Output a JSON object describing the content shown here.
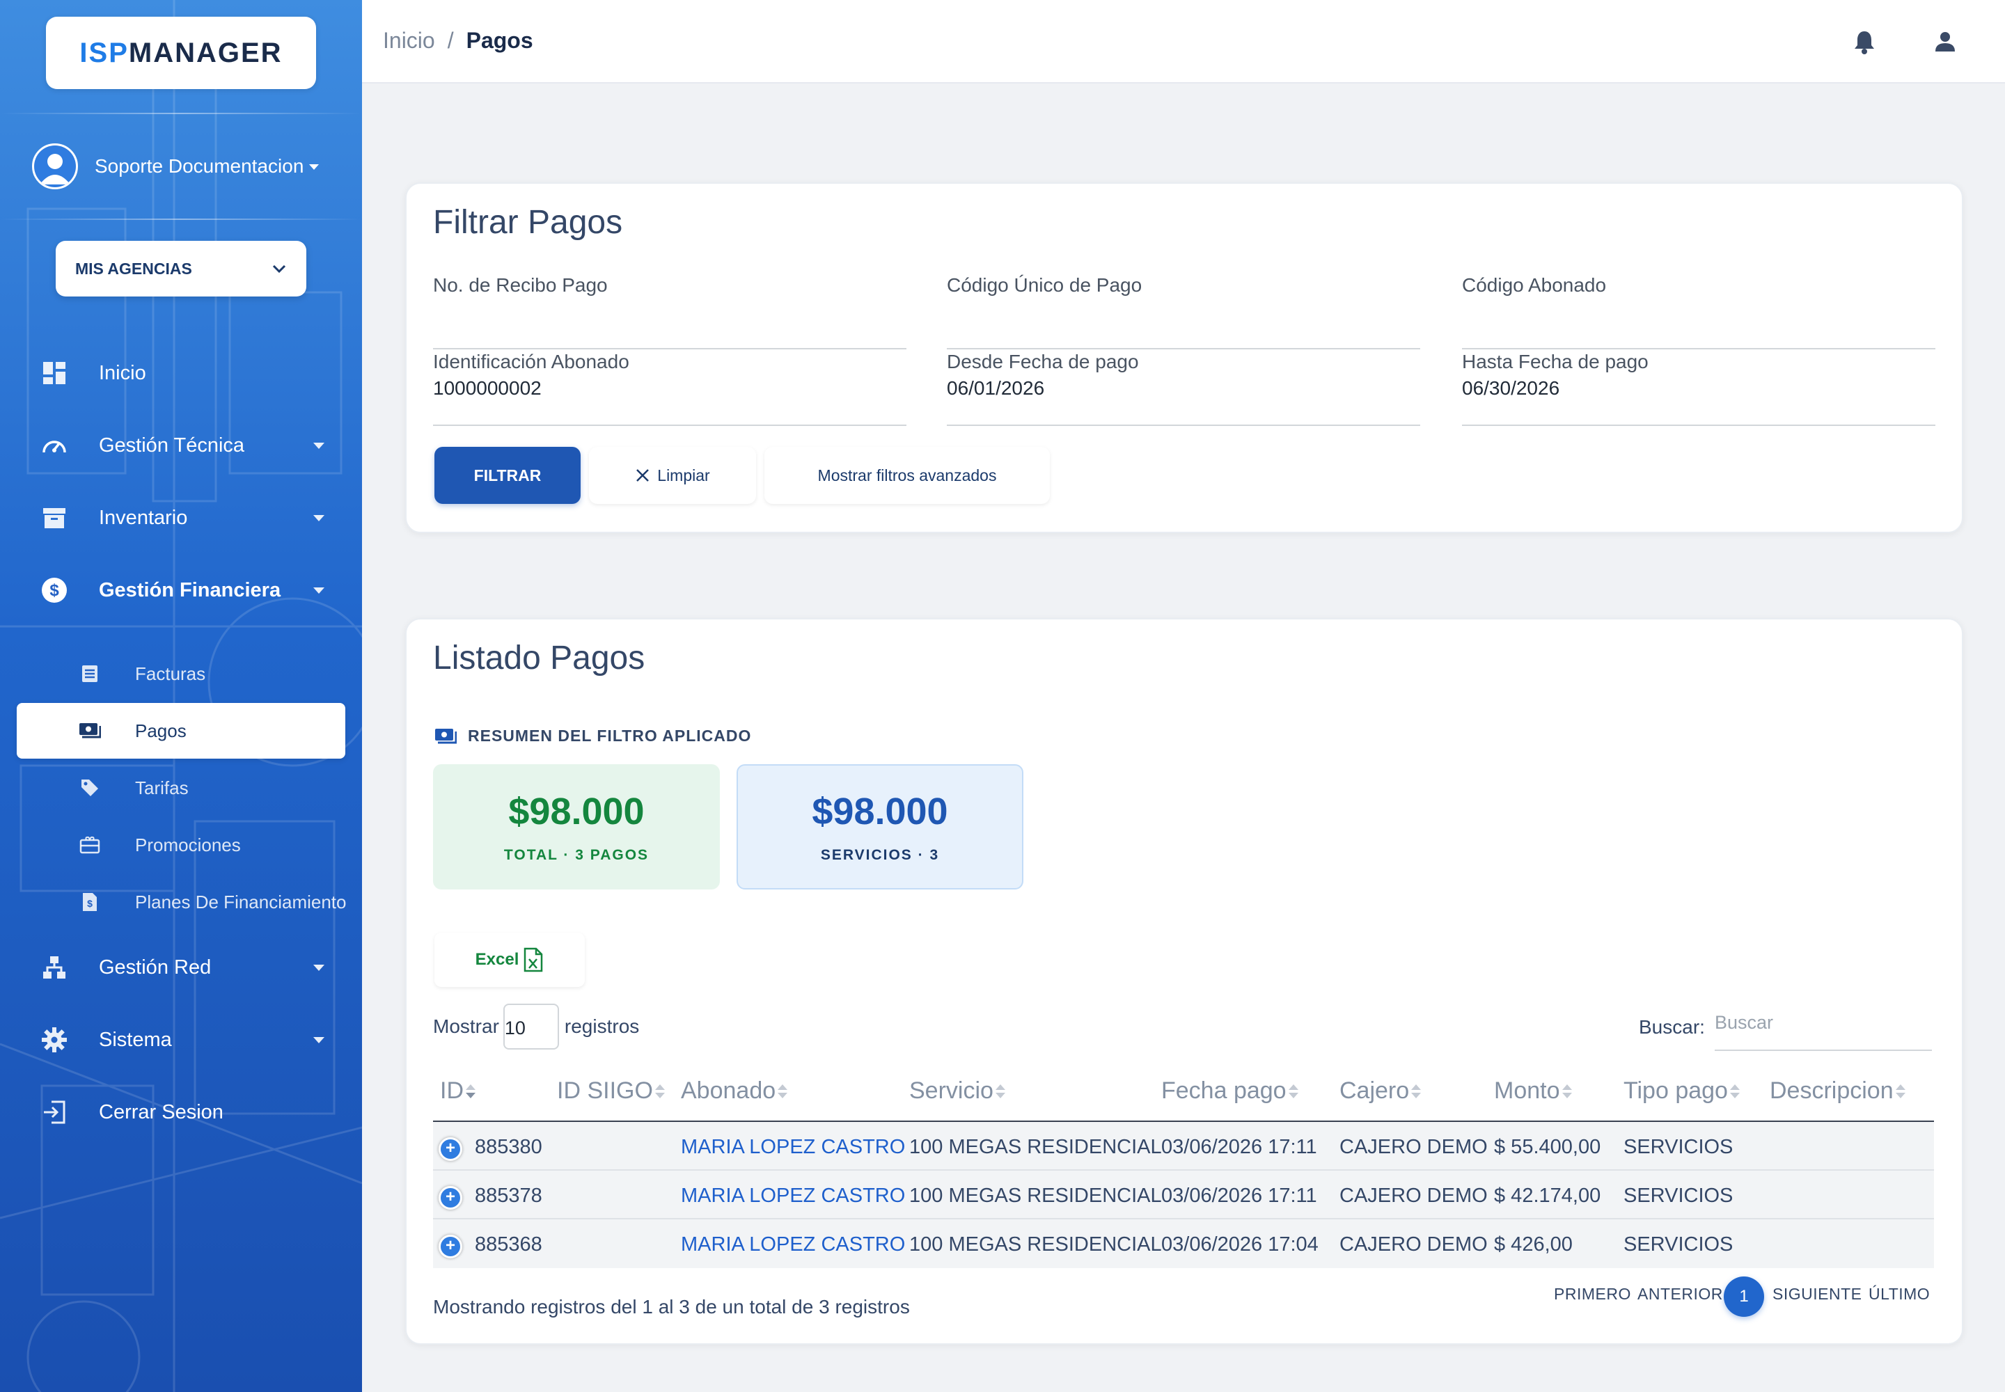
{
  "brand": {
    "logo_part1": "ISP",
    "logo_part2": "MANAGER"
  },
  "user": {
    "name": "Soporte Documentacion"
  },
  "agency_select": {
    "label": "MIS AGENCIAS"
  },
  "nav": {
    "inicio": "Inicio",
    "gestion_tecnica": "Gestión Técnica",
    "inventario": "Inventario",
    "gestion_financiera": "Gestión Financiera",
    "sub": {
      "facturas": "Facturas",
      "pagos": "Pagos",
      "tarifas": "Tarifas",
      "promociones": "Promociones",
      "planes": "Planes De Financiamiento"
    },
    "gestion_red": "Gestión Red",
    "sistema": "Sistema",
    "cerrar": "Cerrar Sesion"
  },
  "breadcrumb": {
    "home": "Inicio",
    "separator": "/",
    "current": "Pagos"
  },
  "filter": {
    "title": "Filtrar Pagos",
    "fields": {
      "recibo": {
        "label": "No. de Recibo Pago",
        "value": ""
      },
      "codigo_unico": {
        "label": "Código Único de Pago",
        "value": ""
      },
      "codigo_abonado": {
        "label": "Código Abonado",
        "value": ""
      },
      "identificacion": {
        "label": "Identificación Abonado",
        "value": "1000000002"
      },
      "desde": {
        "label": "Desde Fecha de pago",
        "value": "06/01/2026"
      },
      "hasta": {
        "label": "Hasta Fecha de pago",
        "value": "06/30/2026"
      }
    },
    "btn_filter": "FILTRAR",
    "btn_clear": "Limpiar",
    "btn_advanced": "Mostrar filtros avanzados"
  },
  "list": {
    "title": "Listado Pagos",
    "summary_title": "RESUMEN DEL FILTRO APLICADO",
    "stats": [
      {
        "value": "$98.000",
        "caption": "TOTAL · 3 PAGOS"
      },
      {
        "value": "$98.000",
        "caption": "SERVICIOS · 3"
      }
    ],
    "excel_label": "Excel",
    "show_label": "Mostrar",
    "show_value": "10",
    "records_label": "registros",
    "search_label": "Buscar:",
    "search_placeholder": "Buscar",
    "columns": [
      "ID",
      "ID SIIGO",
      "Abonado",
      "Servicio",
      "Fecha pago",
      "Cajero",
      "Monto",
      "Tipo pago",
      "Descripcion"
    ],
    "rows": [
      {
        "id": "885380",
        "siigo": "",
        "abonado": "MARIA LOPEZ CASTRO",
        "servicio": "100 MEGAS RESIDENCIAL",
        "fecha": "03/06/2026 17:11",
        "cajero": "CAJERO DEMO",
        "monto": "$ 55.400,00",
        "tipo": "SERVICIOS",
        "desc": ""
      },
      {
        "id": "885378",
        "siigo": "",
        "abonado": "MARIA LOPEZ CASTRO",
        "servicio": "100 MEGAS RESIDENCIAL",
        "fecha": "03/06/2026 17:11",
        "cajero": "CAJERO DEMO",
        "monto": "$ 42.174,00",
        "tipo": "SERVICIOS",
        "desc": ""
      },
      {
        "id": "885368",
        "siigo": "",
        "abonado": "MARIA LOPEZ CASTRO",
        "servicio": "100 MEGAS RESIDENCIAL",
        "fecha": "03/06/2026 17:04",
        "cajero": "CAJERO DEMO",
        "monto": "$ 426,00",
        "tipo": "SERVICIOS",
        "desc": ""
      }
    ],
    "info": "Mostrando registros del 1 al 3 de un total de 3 registros",
    "pager": {
      "first": "PRIMERO",
      "prev": "ANTERIOR",
      "current": "1",
      "next": "SIGUIENTE",
      "last": "ÚLTIMO"
    }
  },
  "colors": {
    "primary": "#1f57b3",
    "link": "#1e5fcc",
    "green": "#14863e"
  }
}
